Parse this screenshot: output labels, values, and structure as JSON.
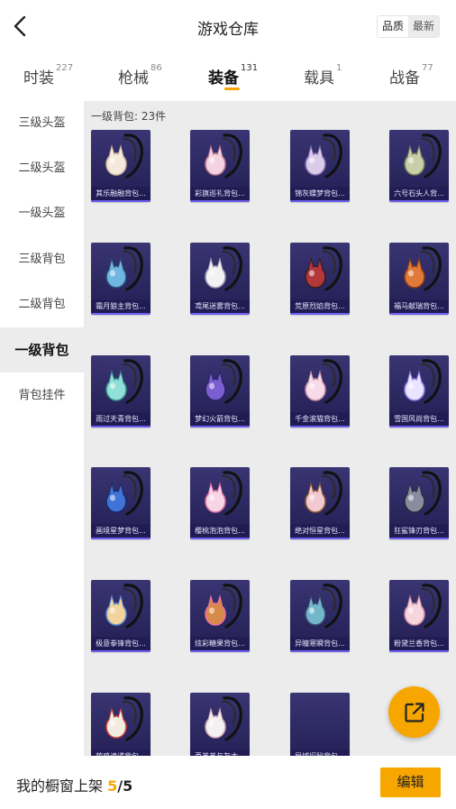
{
  "header": {
    "title": "游戏仓库",
    "sort_options": [
      {
        "label": "品质",
        "active": true
      },
      {
        "label": "最新",
        "active": false
      }
    ]
  },
  "tabs": [
    {
      "label": "时装",
      "count": "227",
      "selected": false
    },
    {
      "label": "枪械",
      "count": "86",
      "selected": false
    },
    {
      "label": "装备",
      "count": "131",
      "selected": true
    },
    {
      "label": "载具",
      "count": "1",
      "selected": false
    },
    {
      "label": "战备",
      "count": "77",
      "selected": false
    }
  ],
  "sidebar": {
    "items": [
      {
        "label": "三级头盔",
        "selected": false
      },
      {
        "label": "二级头盔",
        "selected": false
      },
      {
        "label": "一级头盔",
        "selected": false
      },
      {
        "label": "三级背包",
        "selected": false
      },
      {
        "label": "二级背包",
        "selected": false
      },
      {
        "label": "一级背包",
        "selected": true
      },
      {
        "label": "背包挂件",
        "selected": false
      }
    ]
  },
  "section": {
    "title": "一级背包: 23件"
  },
  "items": [
    {
      "name": "其乐融融背包...",
      "icon": "bunny-pouch-backpack-icon"
    },
    {
      "name": "彩旗巡礼背包...",
      "icon": "bow-pouch-backpack-icon"
    },
    {
      "name": "锦灰蝶梦背包...",
      "icon": "butterfly-pouch-backpack-icon"
    },
    {
      "name": "六号石头人背...",
      "icon": "stone-man-backpack-icon"
    },
    {
      "name": "霜月狼主背包...",
      "icon": "moon-wolf-backpack-icon"
    },
    {
      "name": "鸢尾迷雾背包...",
      "icon": "iris-mist-backpack-icon"
    },
    {
      "name": "荒原烈焰背包...",
      "icon": "flame-mask-backpack-icon"
    },
    {
      "name": "福马献瑞背包...",
      "icon": "lucky-horse-backpack-icon"
    },
    {
      "name": "雨过天青背包...",
      "icon": "celadon-backpack-icon"
    },
    {
      "name": "梦幻火箭背包...",
      "icon": "dream-rocket-backpack-icon"
    },
    {
      "name": "千金滚猫背包...",
      "icon": "rolling-cat-backpack-icon"
    },
    {
      "name": "雪国风尚背包...",
      "icon": "snow-bunny-backpack-icon"
    },
    {
      "name": "画境星梦背包...",
      "icon": "star-dream-backpack-icon"
    },
    {
      "name": "樱桃泡泡背包...",
      "icon": "cherry-bubble-backpack-icon"
    },
    {
      "name": "绝对恒星背包...",
      "icon": "absolute-star-backpack-icon"
    },
    {
      "name": "狂鲨锋刃背包...",
      "icon": "mad-shark-backpack-icon"
    },
    {
      "name": "极意拳锋背包...",
      "icon": "fist-backpack-icon"
    },
    {
      "name": "炫彩糖果背包...",
      "icon": "candy-donut-backpack-icon"
    },
    {
      "name": "异瞳寒瞬背包...",
      "icon": "cold-eye-backpack-icon"
    },
    {
      "name": "粉黛兰香背包...",
      "icon": "pink-bunny-backpack-icon"
    },
    {
      "name": "萌鸡速递背包...",
      "icon": "chick-express-backpack-icon"
    },
    {
      "name": "喜羊羊与灰太...",
      "icon": "pleasant-goat-backpack-icon"
    },
    {
      "name": "异域探秘背包...",
      "icon": "exotic-explore-backpack-icon"
    }
  ],
  "footer": {
    "prefix": "我的橱窗上架",
    "count": "5",
    "total": "/5",
    "edit_label": "编辑"
  },
  "colors": {
    "accent": "#f7a600",
    "card_bg": "#2c2860",
    "panel_bg": "#ececec"
  },
  "icons": {
    "back": "chevron-left-icon",
    "share": "share-external-icon"
  }
}
